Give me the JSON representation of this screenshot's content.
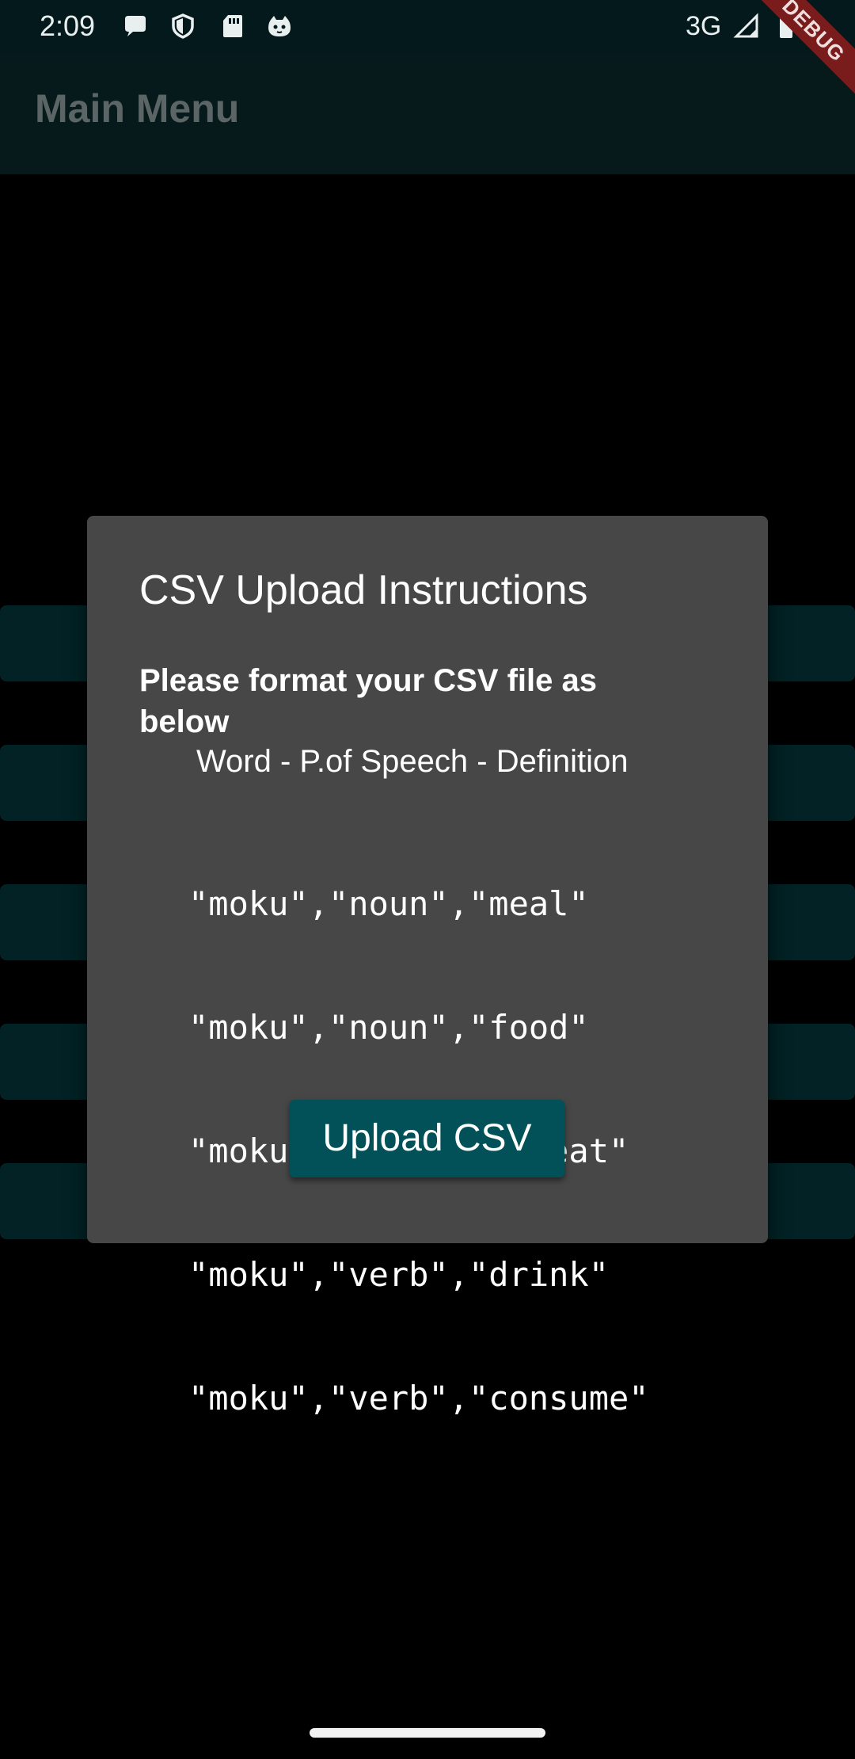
{
  "status_bar": {
    "time": "2:09",
    "network": "3G",
    "icons": [
      "chat-bubble-icon",
      "shield-icon",
      "sd-card-icon",
      "cat-face-icon",
      "signal-icon",
      "battery-icon"
    ]
  },
  "app_bar": {
    "title": "Main Menu"
  },
  "debug_banner": "DEBUG",
  "background_buttons": [
    {
      "label": ""
    },
    {
      "label": ""
    },
    {
      "label": ""
    },
    {
      "label": ""
    },
    {
      "label": ""
    }
  ],
  "dialog": {
    "title": "CSV Upload Instructions",
    "body": "Please format your CSV file as below",
    "columns": "Word - P.of Speech - Definition",
    "examples": [
      "\"moku\",\"noun\",\"meal\"",
      "\"moku\",\"noun\",\"food\"",
      "\"moku\",\"verb\",\"to eat\"",
      "\"moku\",\"verb\",\"drink\"",
      "\"moku\",\"verb\",\"consume\""
    ],
    "upload_label": "Upload CSV"
  },
  "colors": {
    "dialog_bg": "#474747",
    "accent": "#025158",
    "app_bar": "#06191b"
  }
}
